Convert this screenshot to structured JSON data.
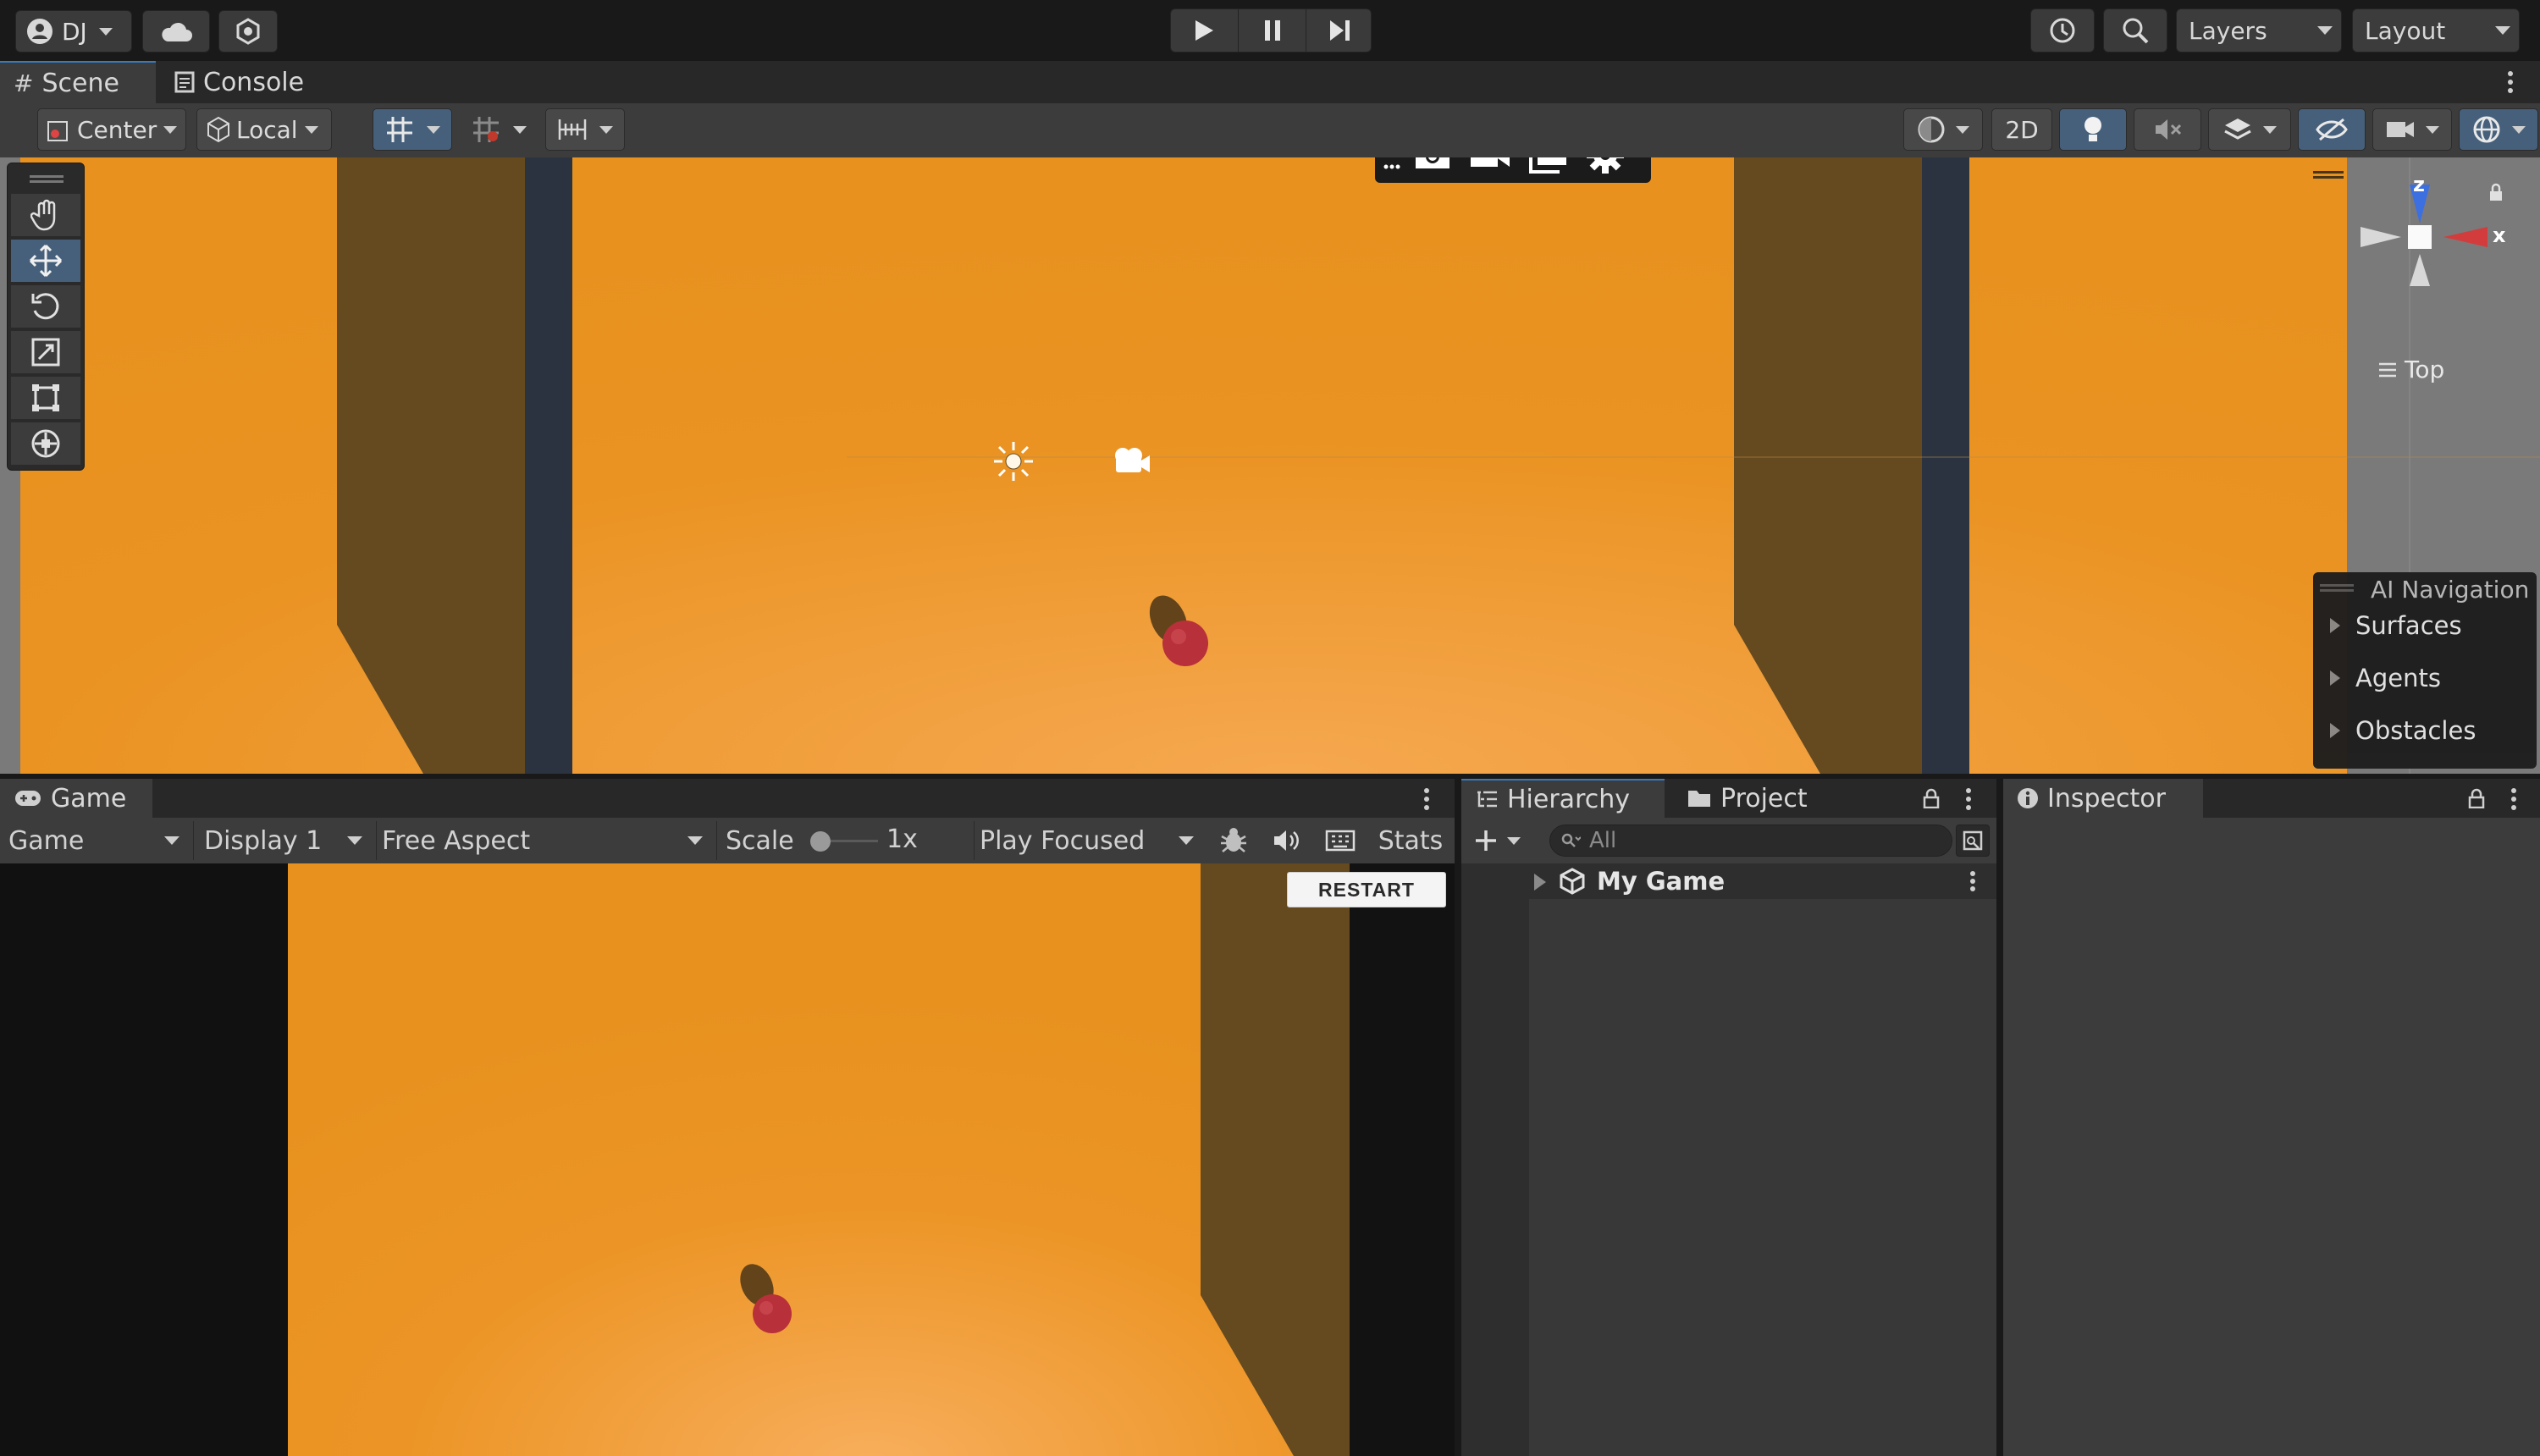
{
  "topbar": {
    "account_label": "DJ",
    "layers_label": "Layers",
    "layout_label": "Layout"
  },
  "scene_panel": {
    "tabs": [
      {
        "label": "Scene",
        "icon": "hash-icon"
      },
      {
        "label": "Console",
        "icon": "console-icon"
      }
    ],
    "pivot_label": "Center",
    "space_label": "Local",
    "view_2d_label": "2D",
    "orientation_label": "Top",
    "gizmo_axis_z": "z",
    "gizmo_axis_x": "x",
    "ai_navigation": {
      "title": "AI Navigation",
      "items": [
        "Surfaces",
        "Agents",
        "Obstacles"
      ]
    }
  },
  "game_panel": {
    "tab_label": "Game",
    "mode_label": "Game",
    "display_label": "Display 1",
    "aspect_label": "Free Aspect",
    "scale_label": "Scale",
    "scale_value": "1x",
    "play_mode_label": "Play Focused",
    "stats_label": "Stats",
    "restart_label": "RESTART"
  },
  "hierarchy_panel": {
    "tabs": [
      {
        "label": "Hierarchy",
        "icon": "hierarchy-icon"
      },
      {
        "label": "Project",
        "icon": "folder-icon"
      }
    ],
    "search_placeholder": "All",
    "root_item": "My Game"
  },
  "inspector_panel": {
    "tab_label": "Inspector"
  },
  "colors": {
    "scene_orange": "#e8931f",
    "wall_shadow": "#64481f",
    "accent_blue": "#3a79bb",
    "ball_red": "#b8303a"
  }
}
